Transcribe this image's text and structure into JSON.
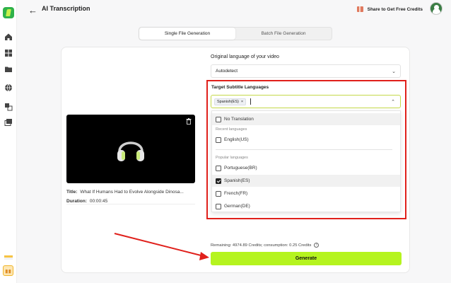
{
  "header": {
    "title": "AI Transcription",
    "share_text": "Share to Get Free Credits"
  },
  "tabs": [
    {
      "label": "Single File Generation",
      "active": true
    },
    {
      "label": "Batch File Generation",
      "active": false
    }
  ],
  "video": {
    "title_label": "Title:",
    "title_value": "What If Humans Had to Evolve Alongside Dinosa...",
    "duration_label": "Duration:",
    "duration_value": "00:00:45"
  },
  "form": {
    "original_lang_label": "Original language of your video",
    "original_lang_value": "Autodetect",
    "target_label": "Target Subtitle Languages",
    "selected_chip": "Spanish(ES)",
    "chip_close": "×"
  },
  "dropdown": {
    "no_translation": "No Translation",
    "recent_label": "Recent languages",
    "popular_label": "Popular languages",
    "options": [
      {
        "label": "English(US)",
        "checked": false
      },
      {
        "label": "Portuguese(BR)",
        "checked": false
      },
      {
        "label": "Spanish(ES)",
        "checked": true
      },
      {
        "label": "French(FR)",
        "checked": false
      },
      {
        "label": "German(DE)",
        "checked": false
      }
    ]
  },
  "footer": {
    "remaining_text": "Remaining: 4974.89 Credits; consumption: 0.25 Credits",
    "info_glyph": "i",
    "generate_label": "Generate"
  },
  "colors": {
    "accent": "#b5f41f",
    "annotation_red": "#e0201b",
    "brand_green": "#2fb24a"
  },
  "sidebar_icons": [
    "home-icon",
    "grid-icon",
    "folder-icon",
    "globe-icon",
    "translate-icon",
    "media-icon",
    "flag-icon",
    "gift-icon"
  ]
}
